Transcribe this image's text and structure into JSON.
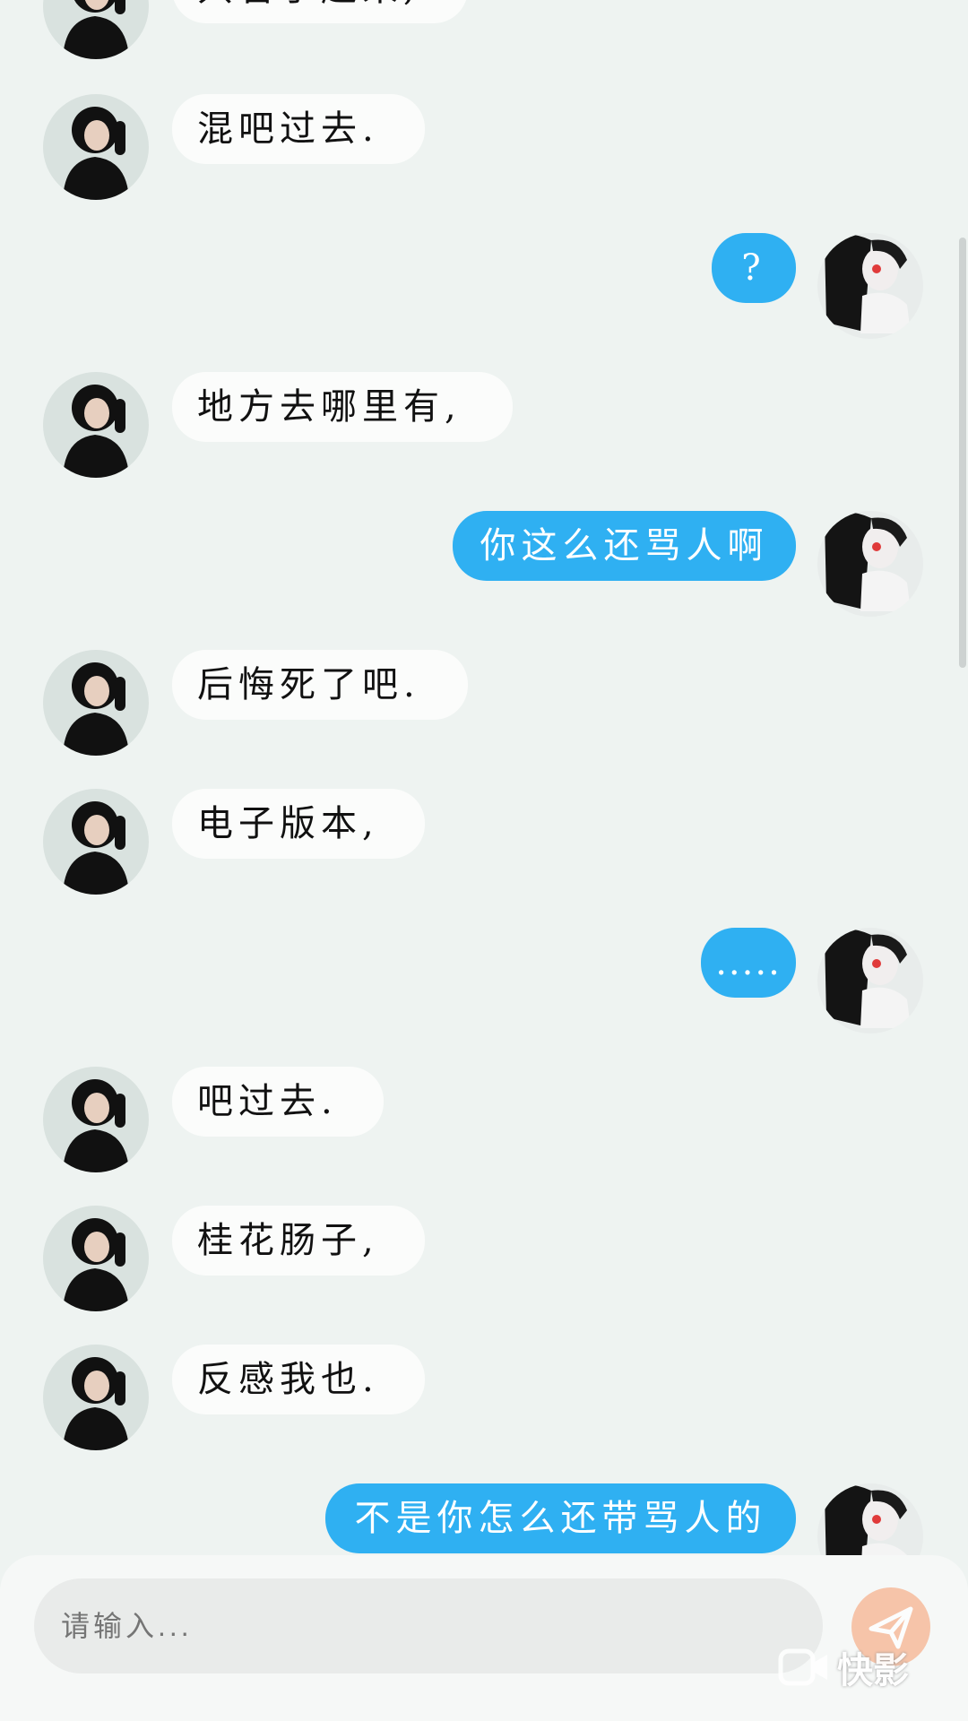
{
  "chat": {
    "messages": [
      {
        "side": "them",
        "text": "只管了起来,"
      },
      {
        "side": "them",
        "text": "混吧过去."
      },
      {
        "side": "me",
        "text": "?"
      },
      {
        "side": "them",
        "text": "地方去哪里有,"
      },
      {
        "side": "me",
        "text": "你这么还骂人啊"
      },
      {
        "side": "them",
        "text": "后悔死了吧."
      },
      {
        "side": "them",
        "text": "电子版本,"
      },
      {
        "side": "me",
        "text": "....."
      },
      {
        "side": "them",
        "text": "吧过去."
      },
      {
        "side": "them",
        "text": "桂花肠子,"
      },
      {
        "side": "them",
        "text": "反感我也."
      },
      {
        "side": "me",
        "text": "不是你怎么还带骂人的"
      }
    ]
  },
  "input": {
    "placeholder": "请输入..."
  },
  "watermark": {
    "text": "快影"
  },
  "icons": {
    "send": "send-icon",
    "watermark": "kuaiying-logo-icon"
  },
  "colors": {
    "my_bubble": "#2fb0f2",
    "their_bubble": "#fbfcfb",
    "background": "#eef3f1"
  }
}
